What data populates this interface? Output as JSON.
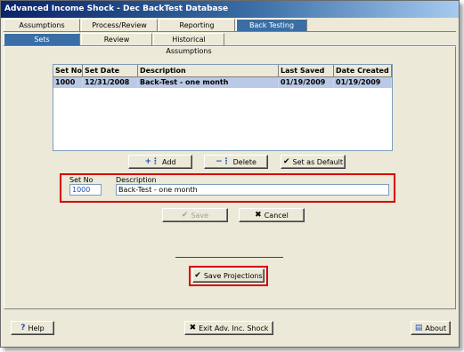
{
  "window": {
    "title": "Advanced Income Shock - Dec BackTest Database"
  },
  "tabs_main": [
    {
      "label": "Assumptions",
      "active": false
    },
    {
      "label": "Process/Review",
      "active": false
    },
    {
      "label": "Reporting",
      "active": false
    },
    {
      "label": "Back Testing",
      "active": true
    }
  ],
  "tabs_sub": [
    {
      "label": "Sets",
      "active": true
    },
    {
      "label": "Review",
      "active": false
    },
    {
      "label": "Historical Assumptions",
      "active": false
    }
  ],
  "grid": {
    "columns": [
      "Set No",
      "Set Date",
      "Description",
      "Last Saved",
      "Date Created"
    ],
    "rows": [
      [
        "1000",
        "12/31/2008",
        "Back-Test - one month",
        "01/19/2009",
        "01/19/2009"
      ]
    ]
  },
  "buttons": {
    "add": "Add",
    "delete": "Delete",
    "set_default": "Set as Default",
    "save": "Save",
    "cancel": "Cancel",
    "save_projections": "Save Projections",
    "help": "Help",
    "exit": "Exit Adv. Inc. Shock",
    "about": "About"
  },
  "form": {
    "setno_label": "Set No",
    "setno_value": "1000",
    "desc_label": "Description",
    "desc_value": "Back-Test - one month"
  },
  "colors": {
    "selected_row": "#b9c9e6",
    "highlight_box": "#d60000",
    "active_tab": "#3a6ea5"
  }
}
